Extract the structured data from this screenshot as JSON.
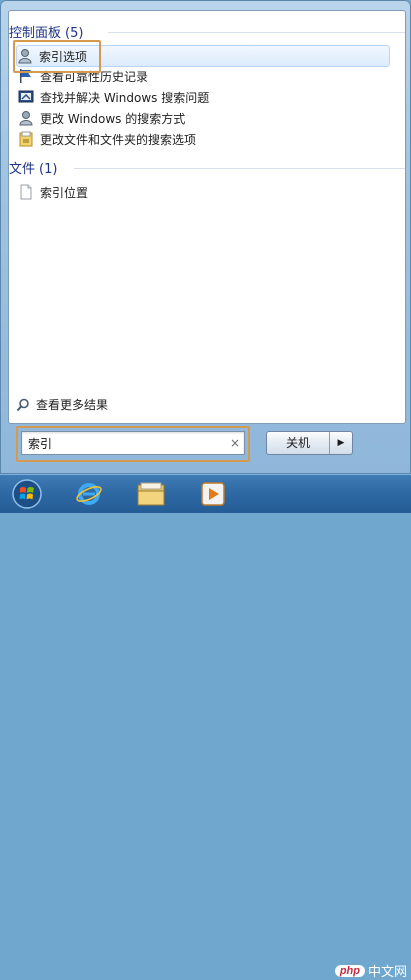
{
  "start_menu": {
    "groups": [
      {
        "title": "控制面板",
        "count": "(5)",
        "items": [
          {
            "label": "索引选项",
            "icon": "indexing-options-icon",
            "selected": true
          },
          {
            "label": "查看可靠性历史记录",
            "icon": "flag-icon",
            "selected": false
          },
          {
            "label": "查找并解决 Windows 搜索问题",
            "icon": "troubleshoot-icon",
            "selected": false
          },
          {
            "label": "更改 Windows 的搜索方式",
            "icon": "search-settings-icon",
            "selected": false
          },
          {
            "label": "更改文件和文件夹的搜索选项",
            "icon": "folder-options-icon",
            "selected": false
          }
        ]
      },
      {
        "title": "文件",
        "count": "(1)",
        "items": [
          {
            "label": "索引位置",
            "icon": "document-icon",
            "selected": false
          }
        ]
      }
    ],
    "see_more": "查看更多结果",
    "search": {
      "value": "索引",
      "clear": "×"
    },
    "shutdown": {
      "label": "关机",
      "arrow": "▶"
    }
  },
  "taskbar": {
    "items": [
      "start-orb-icon",
      "internet-explorer-icon",
      "file-explorer-icon",
      "media-player-icon"
    ]
  },
  "watermark": {
    "brand": "php",
    "text": "中文网"
  },
  "colors": {
    "highlight": "#d59a4f",
    "group_title": "#1e3287",
    "taskbar": "#2f6aa5"
  }
}
